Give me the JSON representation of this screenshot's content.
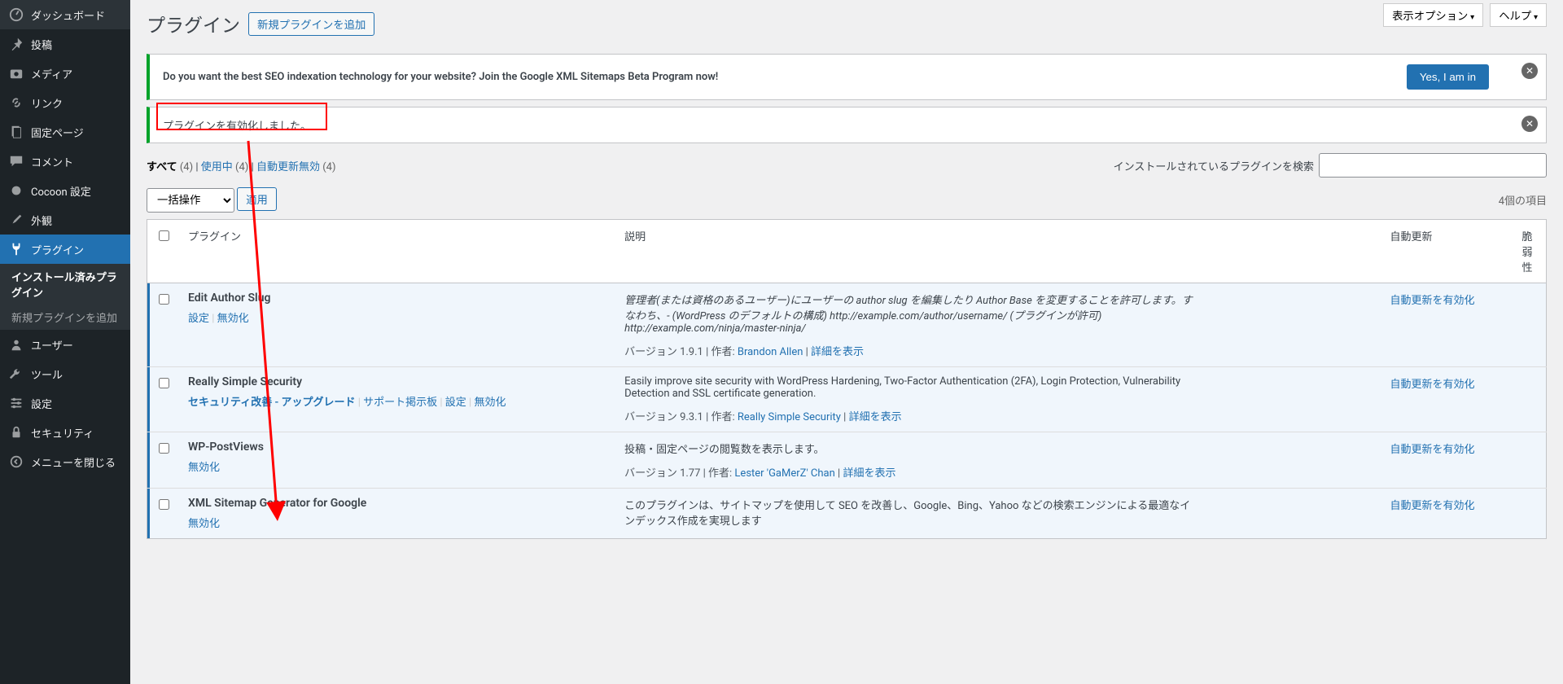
{
  "sidebar": {
    "items": [
      {
        "label": "ダッシュボード"
      },
      {
        "label": "投稿"
      },
      {
        "label": "メディア"
      },
      {
        "label": "リンク"
      },
      {
        "label": "固定ページ"
      },
      {
        "label": "コメント"
      },
      {
        "label": "Cocoon 設定"
      },
      {
        "label": "外観"
      },
      {
        "label": "プラグイン"
      },
      {
        "label": "ユーザー"
      },
      {
        "label": "ツール"
      },
      {
        "label": "設定"
      },
      {
        "label": "セキュリティ"
      },
      {
        "label": "メニューを閉じる"
      }
    ],
    "submenu": {
      "installed": "インストール済みプラグイン",
      "add": "新規プラグインを追加"
    }
  },
  "top": {
    "screen_options": "表示オプション",
    "help": "ヘルプ"
  },
  "header": {
    "title": "プラグイン",
    "add_new": "新規プラグインを追加"
  },
  "notice1": {
    "text": "Do you want the best SEO indexation technology for your website? Join the Google XML Sitemaps Beta Program now!",
    "cta": "Yes, I am in"
  },
  "notice2": {
    "text": "プラグインを有効化しました。"
  },
  "filters": {
    "all": "すべて",
    "all_c": "(4)",
    "active": "使用中",
    "active_c": "(4)",
    "auto": "自動更新無効",
    "auto_c": "(4)",
    "sep": " | "
  },
  "search": {
    "label": "インストールされているプラグインを検索",
    "placeholder": ""
  },
  "bulk": {
    "select": "一括操作",
    "apply": "適用",
    "count": "4個の項目"
  },
  "thead": {
    "plugin": "プラグイン",
    "desc": "説明",
    "auto": "自動更新",
    "vuln": "脆弱性"
  },
  "actions": {
    "settings": "設定",
    "deactivate": "無効化",
    "support": "サポート掲示板",
    "upgrade": "セキュリティ改善 - アップグレード"
  },
  "auto_enable": "自動更新を有効化",
  "rows": [
    {
      "name": "Edit Author Slug",
      "desc": "管理者(または資格のあるユーザー)にユーザーの author slug を編集したり Author Base を変更することを許可します。すなわち、- (WordPress のデフォルトの構成) http://example.com/author/username/ (プラグインが許可) http://example.com/ninja/master-ninja/",
      "meta_v": "バージョン 1.9.1 | 作者: ",
      "author": "Brandon Allen",
      "details": "詳細を表示",
      "acts": [
        "settings",
        "deactivate"
      ]
    },
    {
      "name": "Really Simple Security",
      "desc": "Easily improve site security with WordPress Hardening, Two-Factor Authentication (2FA), Login Protection, Vulnerability Detection and SSL certificate generation.",
      "meta_v": "バージョン 9.3.1 | 作者: ",
      "author": "Really Simple Security",
      "details": "詳細を表示",
      "acts": [
        "upgrade",
        "support",
        "settings",
        "deactivate"
      ]
    },
    {
      "name": "WP-PostViews",
      "desc": "投稿・固定ページの閲覧数を表示します。",
      "meta_v": "バージョン 1.77 | 作者: ",
      "author": "Lester 'GaMerZ' Chan",
      "details": "詳細を表示",
      "acts": [
        "deactivate"
      ]
    },
    {
      "name": "XML Sitemap Generator for Google",
      "desc": "このプラグインは、サイトマップを使用して SEO を改善し、Google、Bing、Yahoo などの検索エンジンによる最適なインデックス作成を実現します",
      "meta_v": "",
      "author": "",
      "details": "",
      "acts": [
        "deactivate"
      ]
    }
  ]
}
